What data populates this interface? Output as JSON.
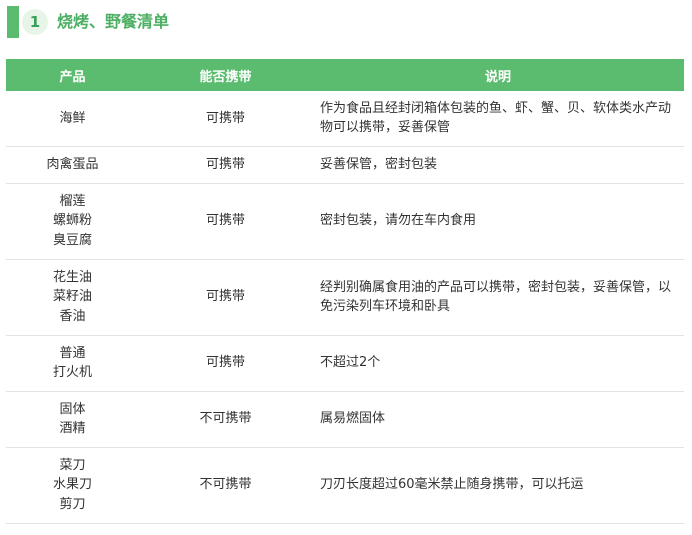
{
  "section": {
    "number": "1",
    "title": "烧烤、野餐清单"
  },
  "table": {
    "headers": [
      "产品",
      "能否携带",
      "说明"
    ],
    "rows": [
      {
        "product": [
          "海鲜"
        ],
        "allowed": "可携带",
        "note": "作为食品且经封闭箱体包装的鱼、虾、蟹、贝、软体类水产动物可以携带，妥善保管"
      },
      {
        "product": [
          "肉禽蛋品"
        ],
        "allowed": "可携带",
        "note": "妥善保管，密封包装"
      },
      {
        "product": [
          "榴莲",
          "螺蛳粉",
          "臭豆腐"
        ],
        "allowed": "可携带",
        "note": "密封包装，请勿在车内食用"
      },
      {
        "product": [
          "花生油",
          "菜籽油",
          "香油"
        ],
        "allowed": "可携带",
        "note": "经判别确属食用油的产品可以携带，密封包装，妥善保管，以免污染列车环境和卧具"
      },
      {
        "product": [
          "普通",
          "打火机"
        ],
        "allowed": "可携带",
        "note": "不超过2个"
      },
      {
        "product": [
          "固体",
          "酒精"
        ],
        "allowed": "不可携带",
        "note": "属易燃固体"
      },
      {
        "product": [
          "菜刀",
          "水果刀",
          "剪刀"
        ],
        "allowed": "不可携带",
        "note": "刀刃长度超过60毫米禁止随身携带，可以托运"
      }
    ]
  }
}
